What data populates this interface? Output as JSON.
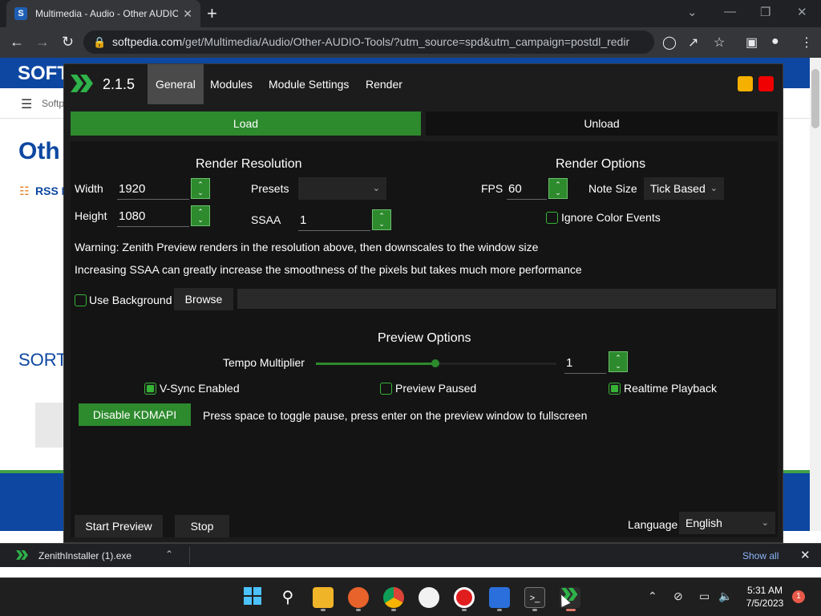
{
  "browser": {
    "tab_title": "Multimedia - Audio - Other AUDIO",
    "tab_favicon": "S",
    "url_host": "softpedia.com",
    "url_path": "/get/Multimedia/Audio/Other-AUDIO-Tools/?utm_source=spd&utm_campaign=postdl_redir",
    "new_tab_glyph": "+",
    "min_glyph": "⌄",
    "minimize_glyph": "—",
    "restore_glyph": "❐",
    "close_glyph": "✕"
  },
  "webpage": {
    "logo": "SOFT",
    "nav_label": "Softp",
    "heading": "Oth",
    "rss": "RSS F",
    "sort": "SORT"
  },
  "app": {
    "version": "2.1.5",
    "tabs": [
      "General",
      "Modules",
      "Module Settings",
      "Render"
    ],
    "active_tab": "General",
    "load_label": "Load",
    "unload_label": "Unload",
    "render_resolution": {
      "title": "Render Resolution",
      "width_label": "Width",
      "width_value": "1920",
      "height_label": "Height",
      "height_value": "1080",
      "presets_label": "Presets",
      "presets_value": "",
      "ssaa_label": "SSAA",
      "ssaa_value": "1"
    },
    "render_options": {
      "title": "Render Options",
      "fps_label": "FPS",
      "fps_value": "60",
      "note_size_label": "Note Size",
      "note_size_value": "Tick Based",
      "ignore_color_events_label": "Ignore Color Events",
      "ignore_color_events_checked": false
    },
    "warning_text": "Warning: Zenith Preview renders in the resolution above, then downscales to the window size",
    "ssaa_text": "Increasing SSAA can greatly increase the smoothness of the pixels but takes much more performance",
    "use_background_label": "Use Background",
    "use_background_checked": false,
    "browse_label": "Browse",
    "background_path": "",
    "preview_options": {
      "title": "Preview Options",
      "tempo_label": "Tempo Multiplier",
      "tempo_value": "1",
      "tempo_slider_fraction": 0.5,
      "vsync_label": "V-Sync Enabled",
      "vsync_checked": true,
      "paused_label": "Preview Paused",
      "paused_checked": false,
      "realtime_label": "Realtime Playback",
      "realtime_checked": true
    },
    "kdmapi_label": "Disable KDMAPI",
    "hint_text": "Press space to toggle pause, press enter on the preview window to fullscreen",
    "start_preview_label": "Start Preview",
    "stop_label": "Stop",
    "language_label": "Language",
    "language_value": "English",
    "colors": {
      "accent": "#2d8a2d",
      "minimize": "#f5b000",
      "close": "#f00000"
    }
  },
  "download_bar": {
    "filename": "ZenithInstaller (1).exe",
    "show_all": "Show all"
  },
  "taskbar": {
    "time": "5:31 AM",
    "date": "7/5/2023",
    "notification_count": "1"
  }
}
